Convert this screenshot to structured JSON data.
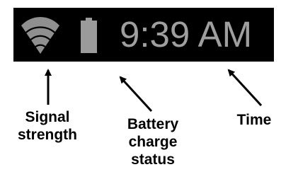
{
  "status_bar": {
    "time": "9:39 AM",
    "signal_icon": "wifi-signal-icon",
    "battery_icon": "battery-icon",
    "colors": {
      "background": "#000000",
      "foreground": "#9f9f9f"
    }
  },
  "callouts": {
    "signal": "Signal\nstrength",
    "battery": "Battery\ncharge\nstatus",
    "time": "Time"
  }
}
